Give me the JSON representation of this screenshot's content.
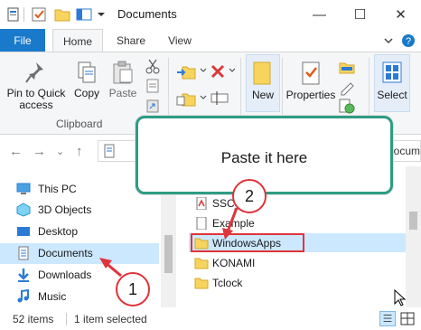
{
  "window": {
    "title": "Documents",
    "minimize": "—",
    "maximize": "☐",
    "close": "✕"
  },
  "ribbon_tabs": [
    {
      "label": "File"
    },
    {
      "label": "Home"
    },
    {
      "label": "Share"
    },
    {
      "label": "View"
    }
  ],
  "ribbon": {
    "pin_label": "Pin to Quick\naccess",
    "copy_label": "Copy",
    "paste_label": "Paste",
    "clipboard_group": "Clipboard",
    "new_label": "New",
    "properties_label": "Properties",
    "select_label": "Select"
  },
  "address": {
    "crumb_partial": "Docum"
  },
  "nav_pane": {
    "items": [
      {
        "label": "This PC",
        "icon": "pc-icon"
      },
      {
        "label": "3D Objects",
        "icon": "3d-objects-icon"
      },
      {
        "label": "Desktop",
        "icon": "desktop-icon"
      },
      {
        "label": "Documents",
        "icon": "documents-icon",
        "selected": true
      },
      {
        "label": "Downloads",
        "icon": "downloads-icon"
      },
      {
        "label": "Music",
        "icon": "music-icon"
      }
    ]
  },
  "files": [
    {
      "name": "SSC_",
      "icon": "pdf-icon"
    },
    {
      "name": "Example",
      "icon": "file-icon"
    },
    {
      "name": "WindowsApps",
      "icon": "folder-icon",
      "selected": true
    },
    {
      "name": "KONAMI",
      "icon": "folder-icon"
    },
    {
      "name": "Tclock",
      "icon": "folder-icon"
    }
  ],
  "status": {
    "item_count": "52 items",
    "selection": "1 item selected"
  },
  "annotations": {
    "callout_text": "Paste it here",
    "step1": "1",
    "step2": "2"
  },
  "colors": {
    "accent": "#1979ca",
    "selection": "#cce8ff",
    "callout_border": "#2e9c84",
    "highlight_red": "#e0333b"
  }
}
